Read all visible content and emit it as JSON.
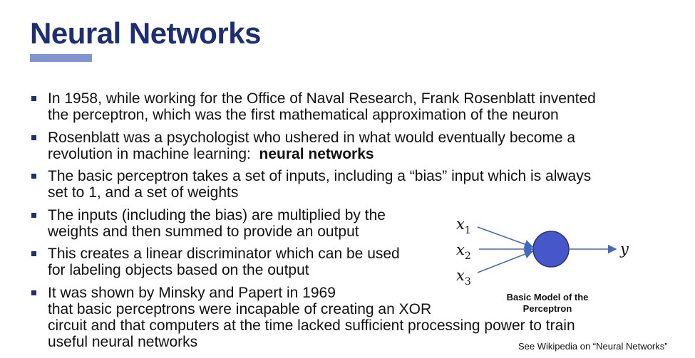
{
  "title": "Neural Networks",
  "bullets": [
    {
      "line1": "In 1958, while working for the Office of Naval Research, Frank Rosenblatt invented",
      "line2": "the perceptron, which was the first mathematical approximation of the neuron"
    },
    {
      "line1": "Rosenblatt was a psychologist who ushered in what would eventually become a",
      "line2_prefix": "revolution in machine learning:  ",
      "line2_bold": "neural networks"
    },
    {
      "line1": "The basic perceptron takes a set of inputs, including a “bias” input which is always",
      "line2": "set to 1, and a set of weights"
    },
    {
      "line1": "The inputs (including the bias) are multiplied by the",
      "line2": "weights and then summed to provide an output"
    },
    {
      "line1": "This creates a linear discriminator which can be used",
      "line2": "for labeling objects based on the output"
    },
    {
      "line1": "It was shown by Minsky and Papert in 1969",
      "line2": "that basic perceptrons were incapable of creating an XOR",
      "line3": "circuit and that computers at the time lacked sufficient processing power to train",
      "line4": "useful neural networks"
    }
  ],
  "diagram": {
    "inputs": [
      {
        "var": "x",
        "sub": "1"
      },
      {
        "var": "x",
        "sub": "2"
      },
      {
        "var": "x",
        "sub": "3"
      }
    ],
    "output": "y",
    "caption_line1": "Basic Model of the",
    "caption_line2": "Perceptron",
    "node_color": "#4557c9",
    "line_color": "#3f6bc4"
  },
  "footnote": "See Wikipedia on “Neural Networks”"
}
